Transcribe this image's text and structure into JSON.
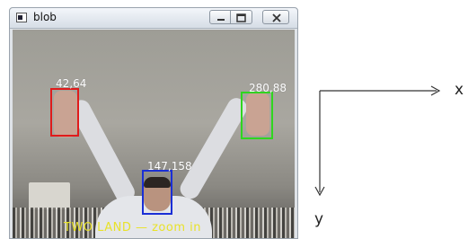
{
  "window": {
    "title": "blob",
    "icons": [
      "app-window-icon",
      "minimize-icon",
      "maximize-icon",
      "close-icon"
    ]
  },
  "camera_view": {
    "blobs": [
      {
        "id": "left-hand",
        "label": "42,64",
        "color": "#e01b1b"
      },
      {
        "id": "right-hand",
        "label": "280,88",
        "color": "#2fd61f"
      },
      {
        "id": "head",
        "label": "147,158",
        "color": "#1a2fd6"
      }
    ],
    "status_text": "TWO LAND — zoom in",
    "status_color": "#e8e22a"
  },
  "axes": {
    "x_label": "x",
    "y_label": "y"
  }
}
